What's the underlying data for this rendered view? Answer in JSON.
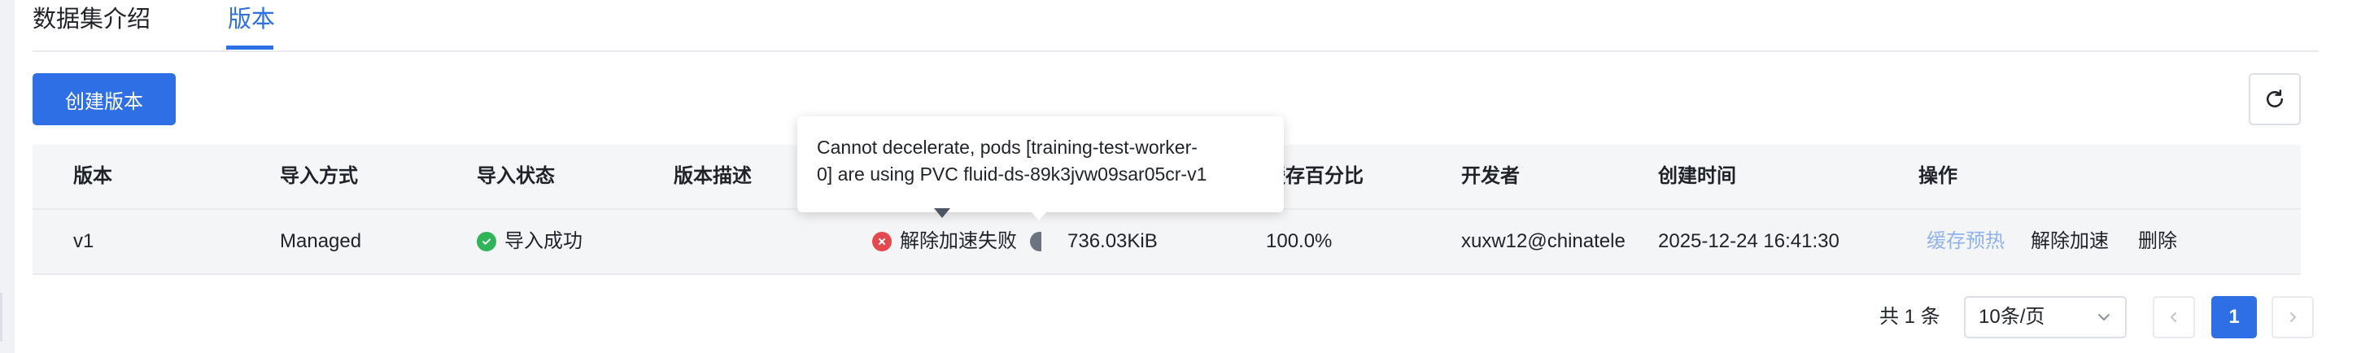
{
  "tabs": [
    {
      "label": "数据集介绍",
      "active": false
    },
    {
      "label": "版本",
      "active": true
    }
  ],
  "toolbar": {
    "create_label": "创建版本",
    "refresh_icon": "refresh-icon"
  },
  "table": {
    "headers": [
      "版本",
      "导入方式",
      "导入状态",
      "版本描述",
      "",
      "",
      "缓存百分比",
      "开发者",
      "创建时间",
      "操作"
    ],
    "rows": [
      {
        "version": "v1",
        "import_method": "Managed",
        "import_status": "导入成功",
        "description": "",
        "accel_status": "解除加速失败",
        "size": "736.03KiB",
        "cache_percent": "100.0%",
        "developer": "xuxw12@chinatele",
        "created_at": "2025-12-24 16:41:30",
        "actions": {
          "warmup": "缓存预热",
          "remove_accel": "解除加速",
          "delete": "删除"
        }
      }
    ]
  },
  "tooltip": {
    "line1": "Cannot decelerate, pods [training-test-worker-",
    "line2": "0] are using PVC fluid-ds-89k3jvw09sar05cr-v1"
  },
  "pagination": {
    "total_text": "共 1 条",
    "page_size": "10条/页",
    "current_page": "1"
  },
  "colors": {
    "accent": "#2f6fe6",
    "success": "#2fb457",
    "error": "#e5484d"
  }
}
